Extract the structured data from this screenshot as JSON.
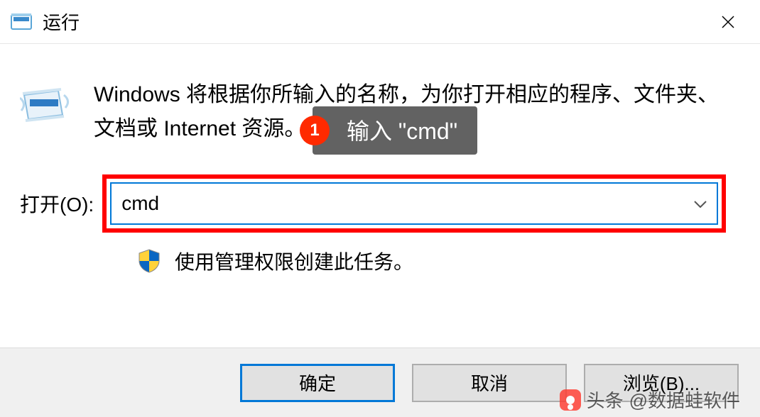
{
  "titlebar": {
    "title": "运行"
  },
  "dialog": {
    "description": "Windows 将根据你所输入的名称，为你打开相应的程序、文件夹、文档或 Internet 资源。",
    "open_label": "打开(O):",
    "input_value": "cmd",
    "admin_text": "使用管理权限创建此任务。"
  },
  "buttons": {
    "ok": "确定",
    "cancel": "取消",
    "browse": "浏览(B)..."
  },
  "callout": {
    "badge": "1",
    "text": "输入 \"cmd\""
  },
  "watermark": {
    "source": "头条",
    "author": "@数据蛙软件"
  }
}
